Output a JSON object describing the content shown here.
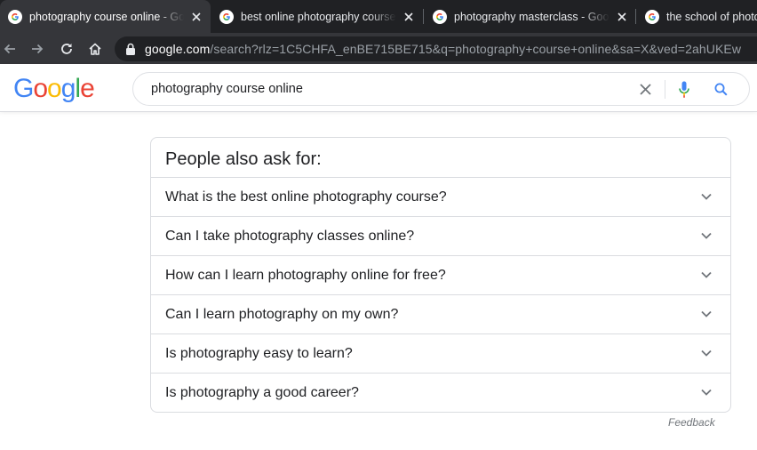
{
  "browser": {
    "tabs": [
      {
        "title": "photography course online - Google Search",
        "active": true
      },
      {
        "title": "best online photography courses - Google Search",
        "active": false
      },
      {
        "title": "photography masterclass - Google Search",
        "active": false
      },
      {
        "title": "the school of photography",
        "active": false
      }
    ],
    "url_host": "google.com",
    "url_path": "/search?rlz=1C5CHFA_enBE715BE715&q=photography+course+online&sa=X&ved=2ahUKEw"
  },
  "search": {
    "query": "photography course online",
    "logo_letters": [
      "G",
      "o",
      "o",
      "g",
      "l",
      "e"
    ],
    "logo_colors": [
      "#4285f4",
      "#ea4335",
      "#fbbc05",
      "#4285f4",
      "#34a853",
      "#ea4335"
    ]
  },
  "paa": {
    "title": "People also ask for:",
    "questions": [
      "What is the best online photography course?",
      "Can I take photography classes online?",
      "How can I learn photography online for free?",
      "Can I learn photography on my own?",
      "Is photography easy to learn?",
      "Is photography a good career?"
    ]
  },
  "feedback_label": "Feedback"
}
